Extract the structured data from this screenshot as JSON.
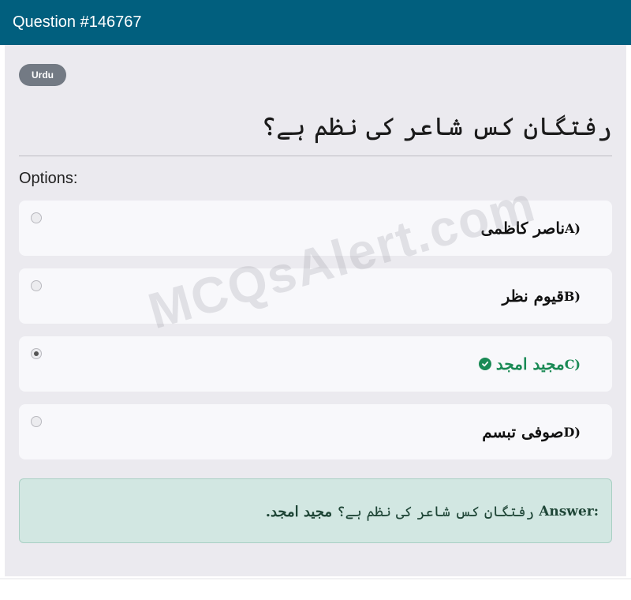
{
  "header": {
    "title": "Question #146767"
  },
  "badge": {
    "label": "Urdu"
  },
  "question": {
    "text": "رفتگان کس شاعر کی نظم ہے؟"
  },
  "options_label": "Options:",
  "options": [
    {
      "letter": "A)",
      "text": "ناصر کاظمی",
      "selected": false,
      "correct": false
    },
    {
      "letter": "B)",
      "text": "قیوم نظر",
      "selected": false,
      "correct": false
    },
    {
      "letter": "C)",
      "text": "مجید امجد",
      "selected": true,
      "correct": true,
      "icon": "check-circle-icon"
    },
    {
      "letter": "D)",
      "text": "صوفی تبسم",
      "selected": false,
      "correct": false
    }
  ],
  "answer": {
    "label": "Answer:",
    "question": "رفتگان کس شاعر کی نظم ہے؟",
    "value": "مجید امجد."
  },
  "watermark": "MCQsAlert.com",
  "colors": {
    "header": "#015f7e",
    "correct": "#1a8a55",
    "answer_bg": "#d2e7e2"
  }
}
